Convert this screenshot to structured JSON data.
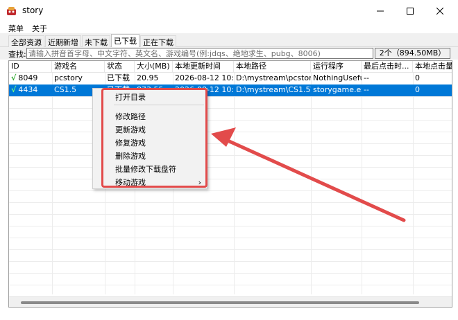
{
  "window": {
    "title": "story",
    "accent": "#0078d7"
  },
  "menu": {
    "items": [
      "菜单",
      "关于"
    ]
  },
  "tabs": [
    {
      "label": "全部资源",
      "active": false
    },
    {
      "label": "近期新增",
      "active": false
    },
    {
      "label": "未下载",
      "active": false
    },
    {
      "label": "已下载",
      "active": true
    },
    {
      "label": "正在下载",
      "active": false
    }
  ],
  "search": {
    "label": "查找:",
    "placeholder": "请输入拼音首字母、中文字符、英文名、游戏编号(例:jdqs、绝地求生、pubg、8006)",
    "count": "2个（894.50MB）"
  },
  "table": {
    "headers": [
      "ID",
      "游戏名",
      "状态",
      "大小(MB)",
      "本地更新时间",
      "本地路径",
      "运行程序",
      "最后点击时...",
      "本地点击量"
    ],
    "rows": [
      {
        "check": "√",
        "id": "8049",
        "name": "pcstory",
        "status": "已下载",
        "size": "20.95",
        "updated": "2026-08-12 10:3...",
        "path": "D:\\mystream\\pcstory\\",
        "exe": "NothingUsefu...",
        "last_click": "--",
        "clicks": "0",
        "selected": false
      },
      {
        "check": "√",
        "id": "4434",
        "name": "CS1.5",
        "status": "已下载",
        "size": "873.55",
        "updated": "2026-08-12 10:3...",
        "path": "D:\\mystream\\CS1.5\\",
        "exe": "storygame.exe",
        "last_click": "--",
        "clicks": "0",
        "selected": true
      }
    ]
  },
  "context_menu": {
    "items": [
      "打开目录",
      "修改路径",
      "更新游戏",
      "修复游戏",
      "删除游戏",
      "批量修改下载盘符",
      "移动游戏"
    ],
    "submenu_arrow": "›"
  },
  "annotation": {
    "color": "#e24b4b"
  }
}
